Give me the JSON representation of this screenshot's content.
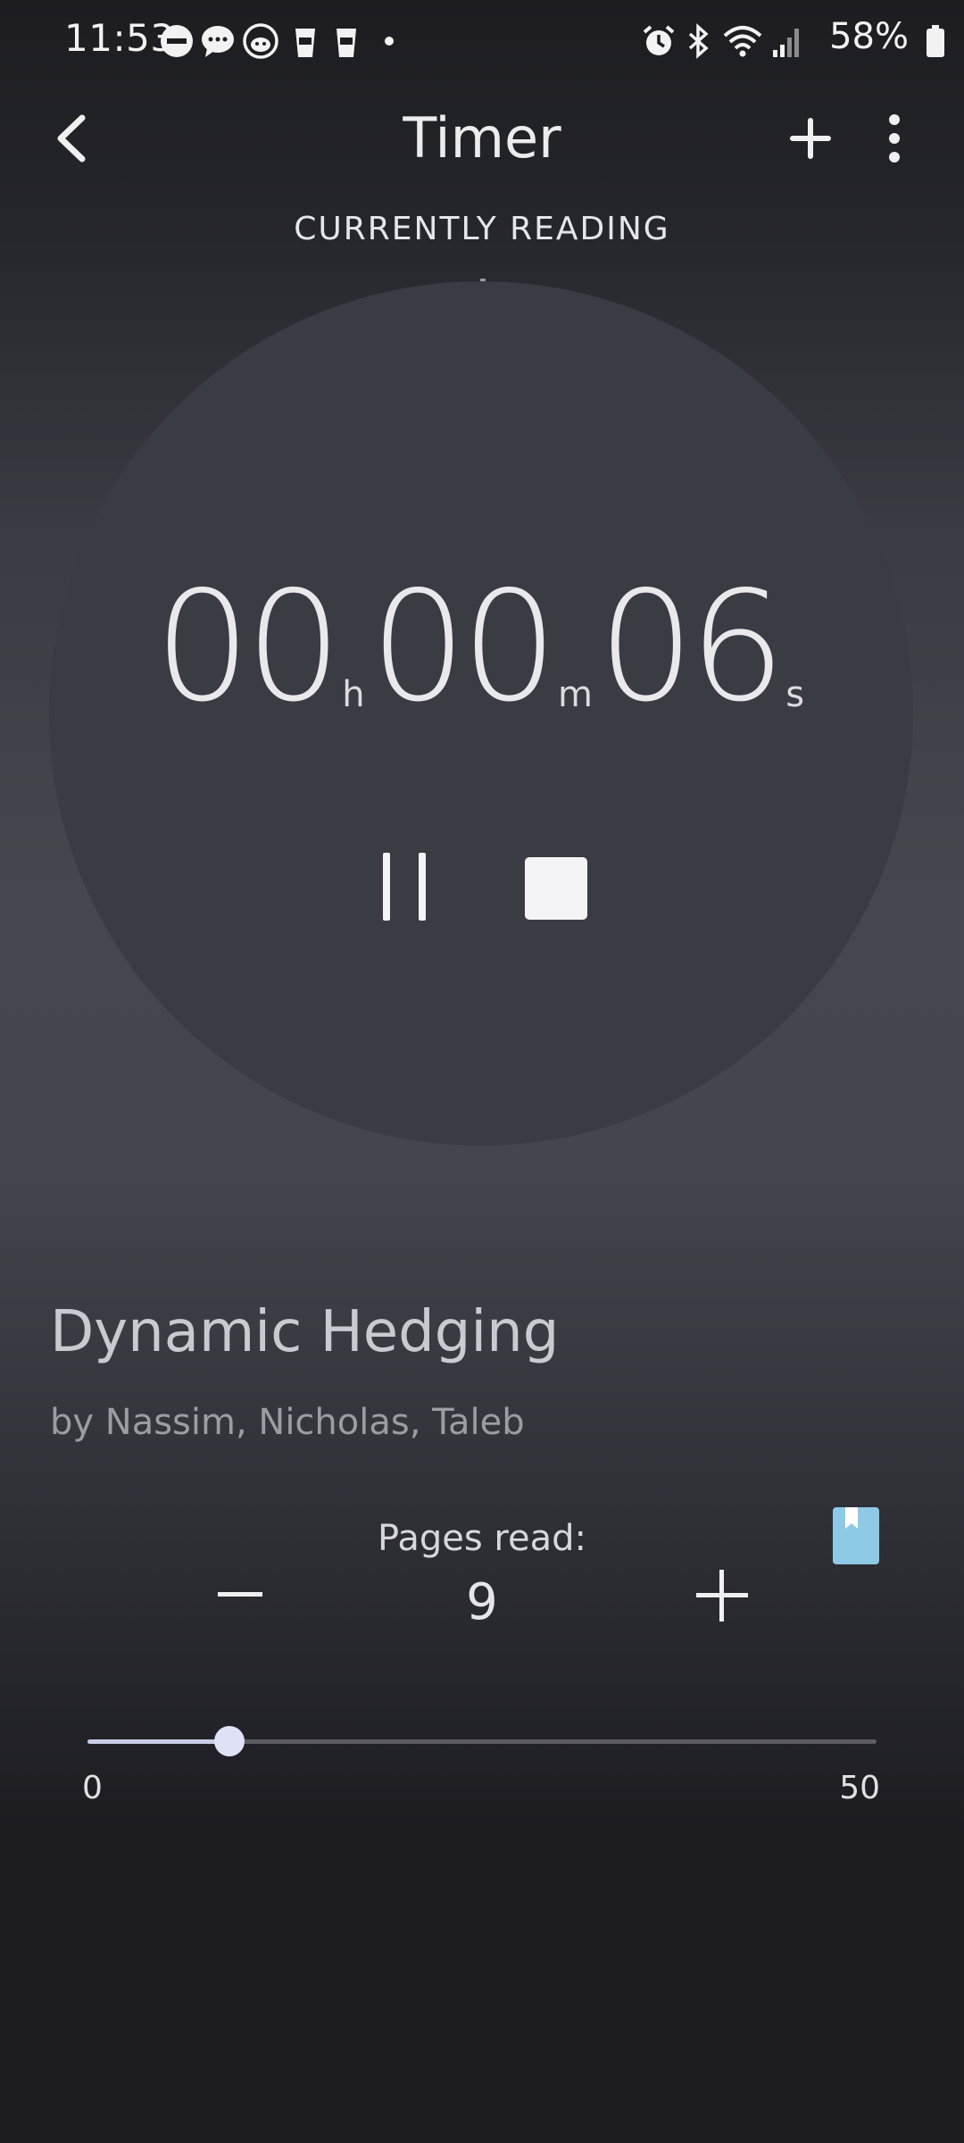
{
  "status_bar": {
    "time": "11:53",
    "battery": "58%",
    "notification_icons": [
      "do-not-disturb-icon",
      "messages-icon",
      "reddit-icon",
      "coffee-cup-icon",
      "coffee-cup-icon",
      "more-dot-icon"
    ],
    "system_icons": [
      "alarm-icon",
      "bluetooth-icon",
      "wifi-icon",
      "signal-icon",
      "battery-icon"
    ]
  },
  "app_bar": {
    "title": "Timer"
  },
  "currently_reading": {
    "label": "CURRENTLY READING",
    "subtitle": "-"
  },
  "timer": {
    "hours": "00",
    "hours_unit": "h",
    "minutes": "00",
    "minutes_unit": "m",
    "seconds": "06",
    "seconds_unit": "s"
  },
  "book": {
    "title": "Dynamic Hedging",
    "author": "by Nassim, Nicholas, Taleb"
  },
  "pages": {
    "label": "Pages read:",
    "value": "9"
  },
  "slider": {
    "min": "0",
    "max": "50",
    "value": 9
  },
  "colors": {
    "accent": "#8ecae6",
    "slider_fill": "#c9cce6"
  }
}
